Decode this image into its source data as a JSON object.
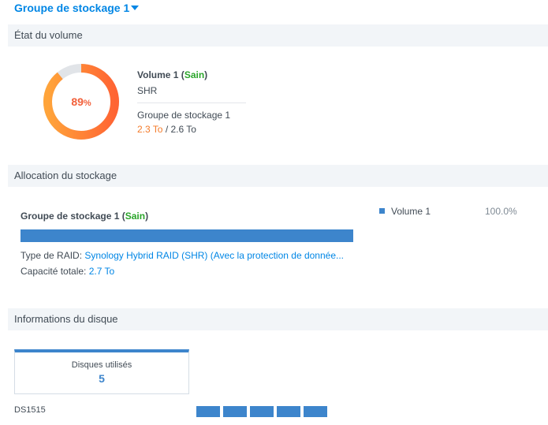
{
  "header": {
    "title": "Groupe de stockage 1"
  },
  "volume_status": {
    "section_title": "État du volume",
    "usage_percent": 89,
    "usage_label": "89",
    "percent_sign": "%",
    "volume_name": "Volume 1",
    "status": "Sain",
    "type": "SHR",
    "pool": "Groupe de stockage 1",
    "used": "2.3 To",
    "total": "2.6 To"
  },
  "allocation": {
    "section_title": "Allocation du stockage",
    "pool_name": "Groupe de stockage 1",
    "status": "Sain",
    "raid_label": "Type de RAID:",
    "raid_value": "Synology Hybrid RAID (SHR) (Avec la protection de donnée...",
    "capacity_label": "Capacité totale:",
    "capacity_value": "2.7 To",
    "legend": [
      {
        "name": "Volume 1",
        "percent": "100.0%",
        "fraction": 1.0
      }
    ]
  },
  "disk_info": {
    "section_title": "Informations du disque",
    "used_label": "Disques utilisés",
    "used_count": "5",
    "model": "DS1515",
    "disk_slots": 5
  },
  "colors": {
    "accent": "#0086e5",
    "bar": "#3d85cc",
    "ok": "#2aa52a",
    "warn": "#f47b2a"
  }
}
